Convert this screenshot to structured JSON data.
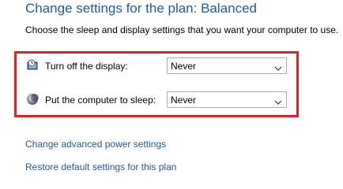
{
  "header": {
    "title": "Change settings for the plan: Balanced",
    "subtitle": "Choose the sleep and display settings that you want your computer to use."
  },
  "settings": [
    {
      "label": "Turn off the display:",
      "value": "Never",
      "icon": "monitor-clock-icon"
    },
    {
      "label": "Put the computer to sleep:",
      "value": "Never",
      "icon": "moon-icon"
    }
  ],
  "links": {
    "advanced": "Change advanced power settings",
    "restore": "Restore default settings for this plan"
  },
  "colors": {
    "title_blue": "#1e5aa8",
    "highlight_red": "#e32028"
  }
}
